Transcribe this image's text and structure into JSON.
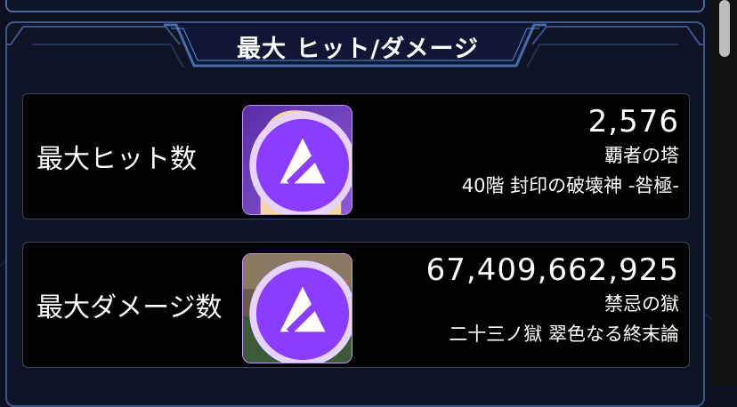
{
  "header": {
    "title": "最大 ヒット/ダメージ"
  },
  "records": [
    {
      "label": "最大ヒット数",
      "value": "2,576",
      "quest": "覇者の塔",
      "stage": "40階 封印の破壊神 -咎極-",
      "avatar_icon": "blonde-girl-character-icon",
      "element_icon": "dark-element-icon"
    },
    {
      "label": "最大ダメージ数",
      "value": "67,409,662,925",
      "quest": "禁忌の獄",
      "stage": "二十三ノ獄 翠色なる終末論",
      "avatar_icon": "dark-haired-soldier-character-icon",
      "element_icon": "dark-element-icon"
    }
  ],
  "colors": {
    "background": "#0c1020",
    "card": "#000000",
    "frame": "#3e5685",
    "element_badge": "#8a3cff"
  }
}
